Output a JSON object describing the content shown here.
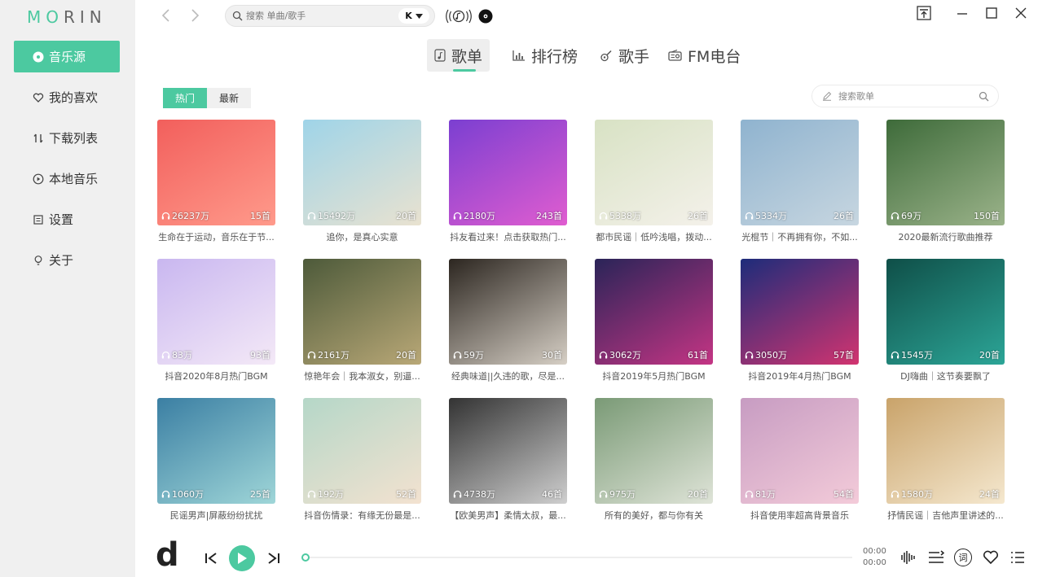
{
  "app": {
    "logo_a": "MO",
    "logo_b": "RIN"
  },
  "sidebar": {
    "items": [
      {
        "label": "音乐源",
        "icon": "disc-icon"
      },
      {
        "label": "我的喜欢",
        "icon": "heart-icon"
      },
      {
        "label": "下载列表",
        "icon": "sort-icon"
      },
      {
        "label": "本地音乐",
        "icon": "play-circle-icon"
      },
      {
        "label": "设置",
        "icon": "settings-icon"
      },
      {
        "label": "关于",
        "icon": "bulb-icon"
      }
    ]
  },
  "header": {
    "search_placeholder": "搜索 单曲/歌手",
    "source_label": "K"
  },
  "tabs": [
    {
      "label": "歌单"
    },
    {
      "label": "排行榜"
    },
    {
      "label": "歌手"
    },
    {
      "label": "FM电台"
    }
  ],
  "subtabs": [
    {
      "label": "热门"
    },
    {
      "label": "最新"
    }
  ],
  "playlist_search": {
    "placeholder": "搜索歌单"
  },
  "playlists": [
    {
      "plays": "26237万",
      "count": "15首",
      "title": "生命在于运动，音乐在于节...",
      "colors": [
        "#f25f5c",
        "#ff9a8b"
      ]
    },
    {
      "plays": "15492万",
      "count": "20首",
      "title": "追你，是真心实意",
      "colors": [
        "#9fd4e8",
        "#e9e2d0"
      ]
    },
    {
      "plays": "2180万",
      "count": "243首",
      "title": "抖友看过来！点击获取热门...",
      "colors": [
        "#7b3fd1",
        "#e05dd0"
      ]
    },
    {
      "plays": "5338万",
      "count": "26首",
      "title": "都市民谣｜低吟浅唱，拨动...",
      "colors": [
        "#d8e2c4",
        "#f4f1ea"
      ]
    },
    {
      "plays": "5334万",
      "count": "26首",
      "title": "光棍节｜不再拥有你，不如...",
      "colors": [
        "#8fb3cf",
        "#c7d6e0"
      ]
    },
    {
      "plays": "69万",
      "count": "150首",
      "title": "2020最新流行歌曲推荐",
      "colors": [
        "#3e6b3a",
        "#9bb38a"
      ]
    },
    {
      "plays": "83万",
      "count": "93首",
      "title": "抖音2020年8月热门BGM",
      "colors": [
        "#c9b7f0",
        "#f4e9f7"
      ]
    },
    {
      "plays": "2161万",
      "count": "20首",
      "title": "惊艳年会｜我本淑女，别逼...",
      "colors": [
        "#4d5a3a",
        "#b9a877"
      ]
    },
    {
      "plays": "59万",
      "count": "30首",
      "title": "经典味道||久违的歌，尽是...",
      "colors": [
        "#2c2620",
        "#d6cfc5"
      ]
    },
    {
      "plays": "3062万",
      "count": "61首",
      "title": "抖音2019年5月热门BGM",
      "colors": [
        "#2a2458",
        "#c43584"
      ]
    },
    {
      "plays": "3050万",
      "count": "57首",
      "title": "抖音2019年4月热门BGM",
      "colors": [
        "#1d2c7a",
        "#d23470"
      ]
    },
    {
      "plays": "1545万",
      "count": "20首",
      "title": "DJ嗨曲｜这节奏要飘了",
      "colors": [
        "#0f4f48",
        "#2ca597"
      ]
    },
    {
      "plays": "1060万",
      "count": "25首",
      "title": "民谣男声|屏蔽纷纷扰扰",
      "colors": [
        "#3b7fa3",
        "#9fd6d8"
      ]
    },
    {
      "plays": "192万",
      "count": "52首",
      "title": "抖音伤情录：有缘无份最是...",
      "colors": [
        "#b5d7c8",
        "#f3e2d0"
      ]
    },
    {
      "plays": "4738万",
      "count": "46首",
      "title": "【欧美男声】柔情太叔，最...",
      "colors": [
        "#333333",
        "#cfcfcf"
      ]
    },
    {
      "plays": "975万",
      "count": "20首",
      "title": "所有的美好，都与你有关",
      "colors": [
        "#7a9a76",
        "#dfe4d8"
      ]
    },
    {
      "plays": "81万",
      "count": "54首",
      "title": "抖音使用率超高背景音乐",
      "colors": [
        "#c79cc2",
        "#f3cbd9"
      ]
    },
    {
      "plays": "1580万",
      "count": "24首",
      "title": "抒情民谣｜吉他声里讲述的...",
      "colors": [
        "#c9a36a",
        "#f5e8cf"
      ]
    }
  ],
  "player": {
    "logo": "d",
    "time_current": "00:00",
    "time_total": "00:00",
    "lyrics_label": "词",
    "progress": 0
  },
  "colors": {
    "accent": "#4cc9a0",
    "sidebar_bg": "#f0f0f0"
  }
}
